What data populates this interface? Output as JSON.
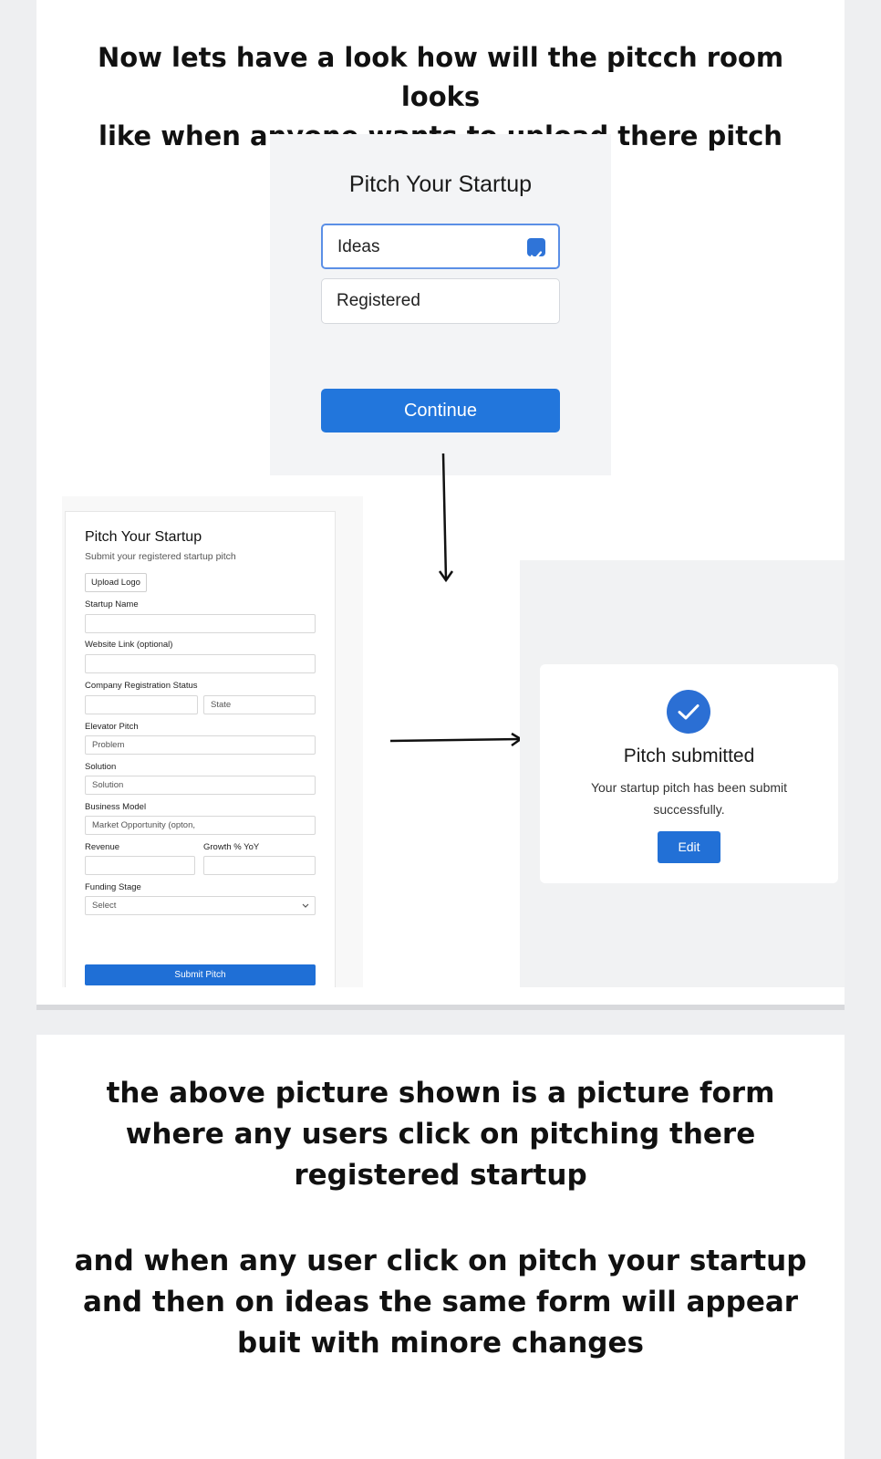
{
  "texts": {
    "top_heading_line1": "Now lets have a look how will the pitcch room looks",
    "top_heading_line2": "like when anyone wants to upload there pitch",
    "para1_line1": "the above picture shown is a picture form",
    "para1_line2": "where any users click on pitching there",
    "para1_line3": "registered startup",
    "para2_line1": "and when any user click on pitch your startup",
    "para2_line2": "and then on ideas the same form will appear",
    "para2_line3": "buit with minore changes"
  },
  "choose_screen": {
    "title": "Pitch Your Startup",
    "options": [
      {
        "label": "Ideas",
        "checked": true
      },
      {
        "label": "Registered",
        "checked": false
      }
    ],
    "continue_label": "Continue"
  },
  "form_screen": {
    "title": "Pitch Your Startup",
    "subtitle": "Submit your registered startup pitch",
    "upload_label": "Upload Logo",
    "startup_name_label": "Startup Name",
    "website_label": "Website Link (optional)",
    "company_status_label": "Company Registration Status",
    "state_placeholder": "State",
    "elevator_label": "Elevator Pitch",
    "problem_placeholder": "Problem",
    "solution_label": "Solution",
    "solution_placeholder": "Solution",
    "business_model_label": "Business Model",
    "market_placeholder": "Market Opportunity (opton,",
    "revenue_label": "Revenue",
    "growth_label": "Growth % YoY",
    "funding_label": "Funding Stage",
    "funding_value": "Select",
    "submit_label": "Submit Pitch"
  },
  "submitted_screen": {
    "title": "Pitch submitted",
    "message_line1": "Your startup pitch has been submit",
    "message_line2": "successfully.",
    "edit_label": "Edit"
  },
  "colors": {
    "primary_blue": "#2276dc",
    "check_blue": "#2b6fd4"
  }
}
